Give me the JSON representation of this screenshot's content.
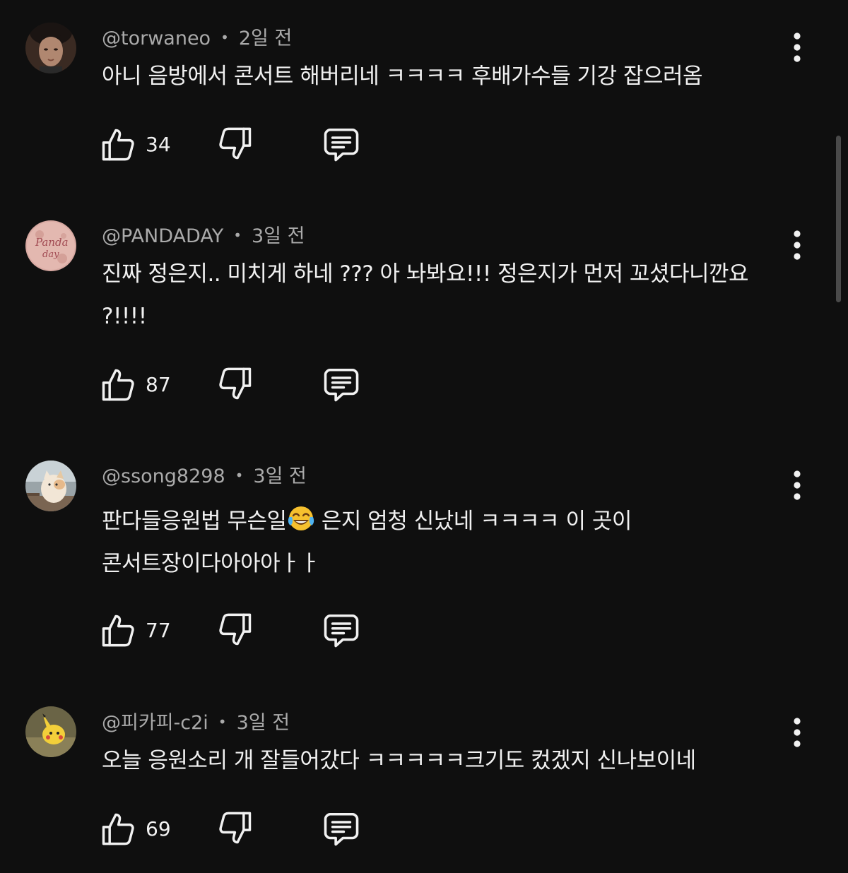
{
  "comments": [
    {
      "author": "@torwaneo",
      "time": "2일 전",
      "text": "아니 음방에서 콘서트 해버리네 ㅋㅋㅋㅋ 후배가수들 기강 잡으러옴",
      "likes": "34"
    },
    {
      "author": "@PANDADAY",
      "time": "3일 전",
      "text": "진짜 정은지.. 미치게 하네 ??? 아 놔봐요!!! 정은지가 먼저 꼬셨다니깐요 ?!!!!",
      "likes": "87"
    },
    {
      "author": "@ssong8298",
      "time": "3일 전",
      "text_before_emoji": "판다들응원법 무슨일",
      "text_after_emoji": " 은지 엄청 신났네 ㅋㅋㅋㅋ 이 곳이 콘서트장이다아아아ㅏㅏ",
      "emoji": "face-with-tears-of-joy",
      "likes": "77"
    },
    {
      "author": "@피카피-c2i",
      "time": "3일 전",
      "text": "오늘 응원소리 개 잘들어갔다 ㅋㅋㅋㅋㅋ크기도 컸겠지 신나보이네",
      "likes": "69"
    }
  ],
  "separator": "•",
  "icons": {
    "like": "thumbs-up-icon",
    "dislike": "thumbs-down-icon",
    "reply": "reply-icon",
    "more": "more-vert-icon"
  },
  "colors": {
    "background": "#0f0f0f",
    "text": "#f1f1f1",
    "secondary": "#aaaaaa"
  }
}
